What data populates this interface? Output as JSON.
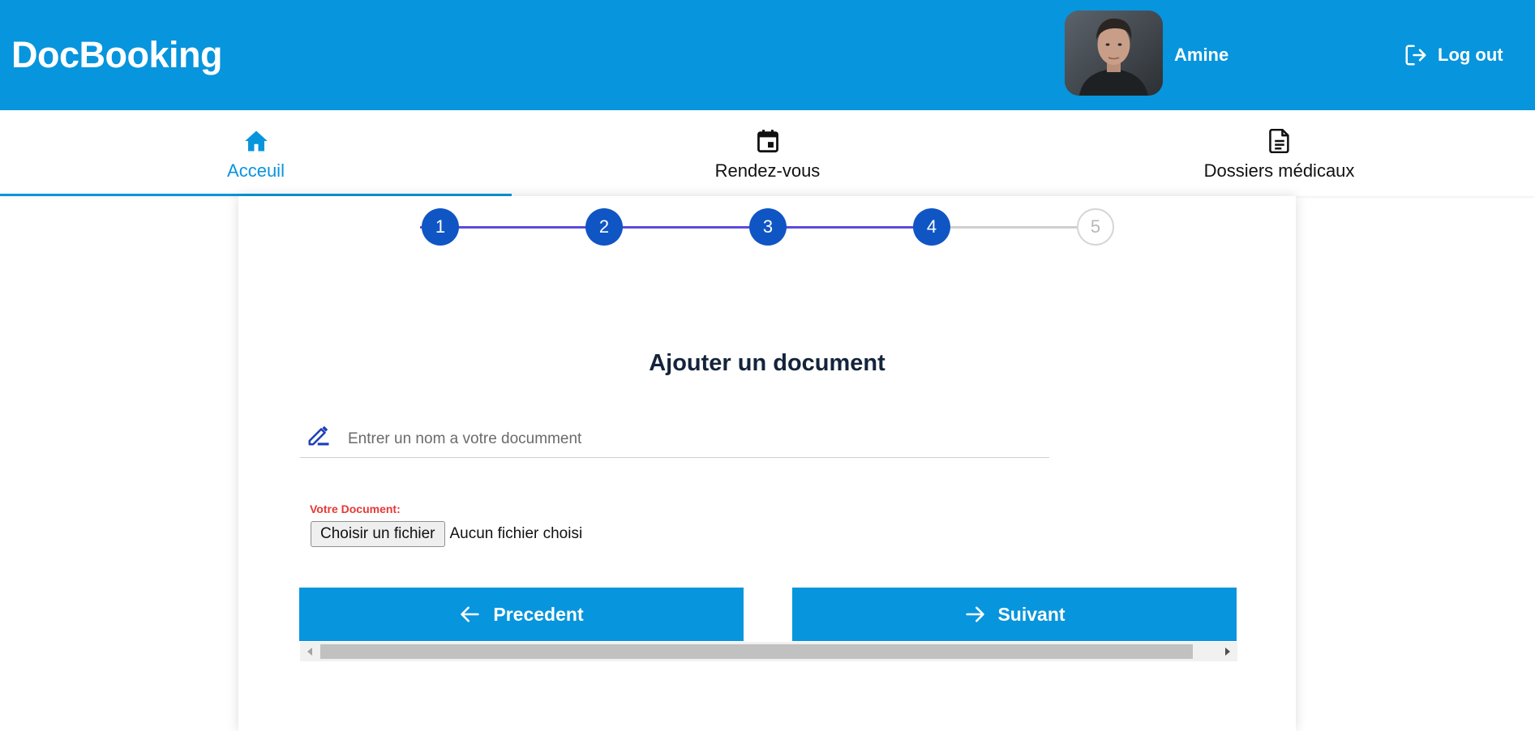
{
  "header": {
    "brand": "DocBooking",
    "user_name": "Amine",
    "logout_label": "Log out",
    "avatar_icon": "user-avatar"
  },
  "nav": {
    "tabs": [
      {
        "label": "Acceuil",
        "icon": "home-icon",
        "active": true
      },
      {
        "label": "Rendez-vous",
        "icon": "calendar-icon",
        "active": false
      },
      {
        "label": "Dossiers médicaux",
        "icon": "document-icon",
        "active": false
      }
    ]
  },
  "stepper": {
    "current_step": 4,
    "steps": [
      "1",
      "2",
      "3",
      "4",
      "5"
    ]
  },
  "form": {
    "title": "Ajouter un document",
    "name_placeholder": "Entrer un nom a votre documment",
    "name_value": "",
    "document_label": "Votre Document:",
    "file_button": "Choisir un fichier",
    "file_status": "Aucun fichier choisi",
    "prev_label": "Precedent",
    "next_label": "Suivant"
  },
  "colors": {
    "primary": "#0795dd",
    "step_done": "#1055c4",
    "step_line": "#5b4bdb",
    "error_label": "#e53935"
  }
}
